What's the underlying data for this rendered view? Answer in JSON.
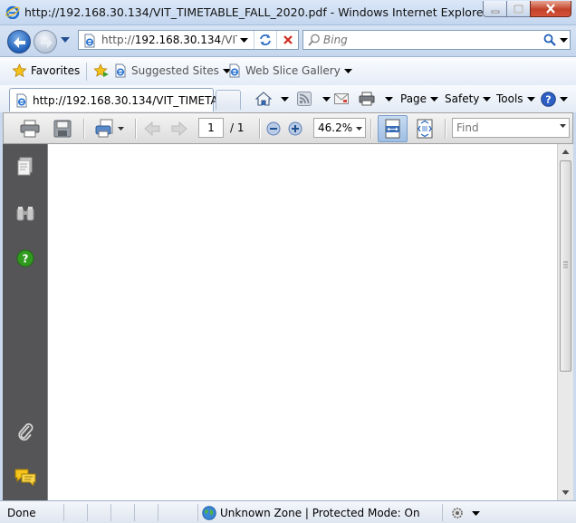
{
  "window": {
    "title": "http://192.168.30.134/VIT_TIMETABLE_FALL_2020.pdf - Windows Internet Explorer"
  },
  "address": {
    "url_prefix": "http://",
    "url_host": "192.168.30.134",
    "url_path": "/VIT_TIMETABLE_FALL_2020.pdf",
    "search_placeholder": "Bing"
  },
  "favorites_bar": {
    "favorites_label": "Favorites",
    "suggested_sites_label": "Suggested Sites",
    "web_slice_gallery_label": "Web Slice Gallery"
  },
  "tabs": [
    {
      "label": "http://192.168.30.134/VIT_TIMETAB..."
    }
  ],
  "command_bar": {
    "page_label": "Page",
    "safety_label": "Safety",
    "tools_label": "Tools"
  },
  "pdf_toolbar": {
    "current_page": "1",
    "page_total": "/ 1",
    "zoom": "46.2%",
    "find_placeholder": "Find"
  },
  "status_bar": {
    "status": "Done",
    "zone": "Unknown Zone | Protected Mode: On"
  },
  "colors": {
    "ie_blue": "#1f5fb8",
    "close_red": "#c2422a",
    "pdf_sidebar": "#555557",
    "help_green": "#2f9a1d"
  }
}
